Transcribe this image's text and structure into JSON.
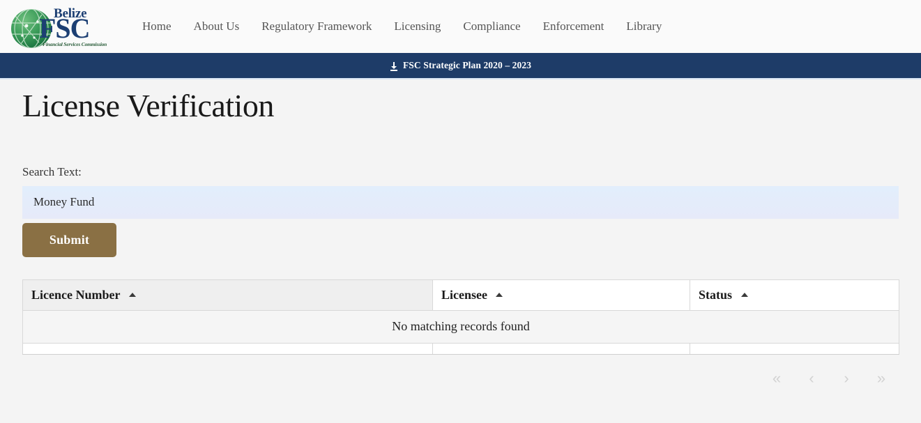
{
  "header": {
    "logo": {
      "brand_top": "Belize",
      "brand_main": "FSC",
      "tagline": "Financial Services Commission"
    },
    "nav": [
      {
        "label": "Home"
      },
      {
        "label": "About Us"
      },
      {
        "label": "Regulatory Framework"
      },
      {
        "label": "Licensing"
      },
      {
        "label": "Compliance"
      },
      {
        "label": "Enforcement"
      },
      {
        "label": "Library"
      }
    ]
  },
  "announcement": {
    "icon": "download-icon",
    "label": "FSC Strategic Plan 2020 – 2023"
  },
  "page": {
    "title": "License Verification"
  },
  "search": {
    "label": "Search Text:",
    "value": "Money Fund",
    "placeholder": "",
    "submit_label": "Submit"
  },
  "table": {
    "columns": [
      {
        "label": "Licence Number",
        "sorted": true,
        "sort_direction": "asc"
      },
      {
        "label": "Licensee",
        "sorted": false,
        "sort_direction": "asc"
      },
      {
        "label": "Status",
        "sorted": false,
        "sort_direction": "asc"
      }
    ],
    "rows": [],
    "empty_message": "No matching records found"
  },
  "pagination": {
    "first_label": "«",
    "prev_label": "‹",
    "next_label": "›",
    "last_label": "»"
  },
  "colors": {
    "banner_navy": "#1e3c68",
    "brand_navy": "#1c3f73",
    "submit_brown": "#8a7044",
    "input_blue": "#e4ecf9",
    "page_background": "#f4f4f4"
  }
}
